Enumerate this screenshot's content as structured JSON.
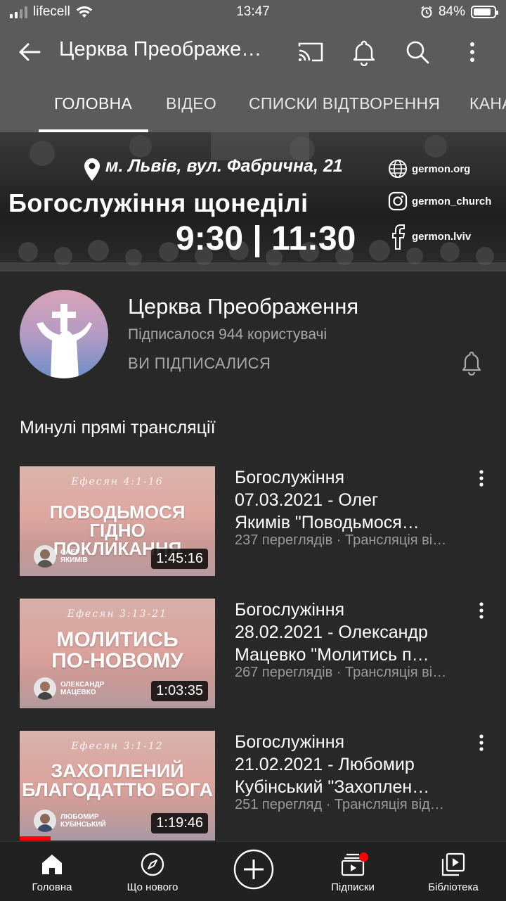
{
  "status_bar": {
    "carrier": "lifecell",
    "time": "13:47",
    "battery_percent": "84%",
    "battery_level": 0.84
  },
  "app_bar": {
    "title": "Церква Преображе…",
    "icons": [
      "back-arrow-icon",
      "cast-icon",
      "bell-icon",
      "search-icon",
      "more-vert-icon"
    ]
  },
  "tabs": [
    {
      "label": "ГОЛОВНА",
      "active": true
    },
    {
      "label": "ВІДЕО",
      "active": false
    },
    {
      "label": "СПИСКИ ВІДТВОРЕННЯ",
      "active": false
    },
    {
      "label": "КАНА",
      "active": false
    }
  ],
  "banner": {
    "location": "м. Львів, вул. Фабрична, 21",
    "headline": "Богослужіння щонеділі",
    "times": "9:30 | 11:30",
    "social": [
      {
        "icon": "globe-icon",
        "text": "germon.org"
      },
      {
        "icon": "instagram-icon",
        "text": "germon_church"
      },
      {
        "icon": "facebook-icon",
        "text": "germon.lviv"
      }
    ]
  },
  "channel": {
    "name": "Церква Преображення",
    "subscribers": "Підписалося 944 користувачі",
    "subscribed_label": "ВИ ПІДПИСАЛИСЯ"
  },
  "section_title": "Минулі прямі трансляції",
  "videos": [
    {
      "verse": "Ефесян 4:1-16",
      "headline_1": "ПОВОДЬМОСЯ ГІДНО",
      "headline_2": "ПОКЛИКАННЯ",
      "speaker_1": "ОЛЕГ",
      "speaker_2": "ЯКИМІВ",
      "duration": "1:45:16",
      "title_1": "Богослужіння",
      "title_2": "07.03.2021 - Олег",
      "title_3": "Якимів \"Поводьмося…",
      "meta": "237 переглядів · Трансляція ві…",
      "watched_fraction": 0
    },
    {
      "verse": "Ефесян 3:13-21",
      "headline_1": "МОЛИТИСЬ",
      "headline_2": "ПО-НОВОМУ",
      "speaker_1": "ОЛЕКСАНДР",
      "speaker_2": "МАЦЕВКО",
      "duration": "1:03:35",
      "title_1": "Богослужіння",
      "title_2": "28.02.2021 - Олександр",
      "title_3": "Мацевко \"Молитись п…",
      "meta": "267 переглядів · Трансляція ві…",
      "watched_fraction": 0
    },
    {
      "verse": "Ефесян 3:1-12",
      "headline_1": "ЗАХОПЛЕНИЙ",
      "headline_2": "БЛАГОДАТТЮ БОГА",
      "speaker_1": "ЛЮБОМИР",
      "speaker_2": "КУБІНСЬКИЙ",
      "duration": "1:19:46",
      "title_1": "Богослужіння",
      "title_2": "21.02.2021 - Любомир",
      "title_3": "Кубінський \"Захоплен…",
      "meta": "251 перегляд · Трансляція від…",
      "watched_fraction": 0.16
    }
  ],
  "bottom_nav": [
    {
      "label": "Головна",
      "icon": "home-icon"
    },
    {
      "label": "Що нового",
      "icon": "explore-compass-icon"
    },
    {
      "label": "",
      "icon": "create-plus-icon"
    },
    {
      "label": "Підписки",
      "icon": "subscriptions-icon",
      "badge": true
    },
    {
      "label": "Бібліотека",
      "icon": "library-icon"
    }
  ],
  "colors": {
    "top_bar": "#5b5b5b",
    "background": "#282828",
    "nav_background": "#212121",
    "accent_red": "#ff0000",
    "secondary_text": "#a8a8a8"
  }
}
